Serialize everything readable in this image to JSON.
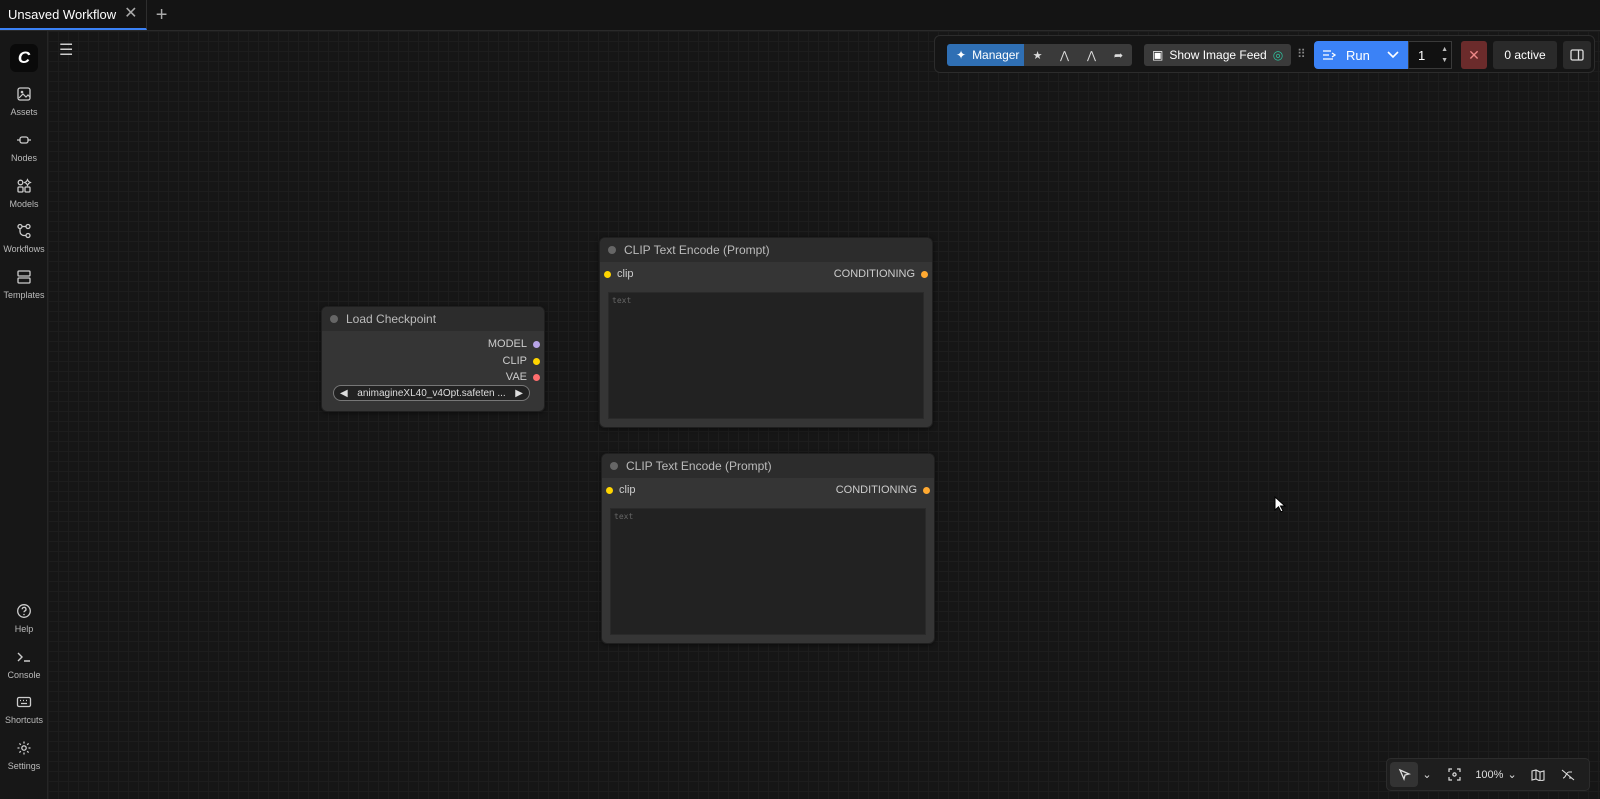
{
  "tabs": [
    {
      "title": "Unsaved Workflow",
      "close_icon": "close-icon"
    }
  ],
  "sidebar": {
    "logo": "C",
    "top_items": [
      {
        "label": "Assets",
        "icon": "image-icon"
      },
      {
        "label": "Nodes",
        "icon": "node-icon"
      },
      {
        "label": "Models",
        "icon": "models-icon"
      },
      {
        "label": "Workflows",
        "icon": "workflow-icon"
      },
      {
        "label": "Templates",
        "icon": "templates-icon"
      }
    ],
    "bottom_items": [
      {
        "label": "Help",
        "icon": "help-icon"
      },
      {
        "label": "Console",
        "icon": "terminal-icon"
      },
      {
        "label": "Shortcuts",
        "icon": "keyboard-icon"
      },
      {
        "label": "Settings",
        "icon": "gear-icon"
      }
    ]
  },
  "toolbar": {
    "manager_label": "Manager",
    "feed_label": "Show Image Feed",
    "run_label": "Run",
    "batch_count": "1",
    "active_label": "0 active"
  },
  "nodes": {
    "load_checkpoint": {
      "title": "Load Checkpoint",
      "outputs": [
        {
          "name": "MODEL",
          "color": "#b7a3e6"
        },
        {
          "name": "CLIP",
          "color": "#ffd500"
        },
        {
          "name": "VAE",
          "color": "#ff6e6e"
        }
      ],
      "ckpt_value": "animagineXL40_v4Opt.safeten ..."
    },
    "clip_encode_1": {
      "title": "CLIP Text Encode (Prompt)",
      "input": "clip",
      "output": "CONDITIONING",
      "placeholder": "text"
    },
    "clip_encode_2": {
      "title": "CLIP Text Encode (Prompt)",
      "input": "clip",
      "output": "CONDITIONING",
      "placeholder": "text"
    }
  },
  "zoom": {
    "level": "100%"
  },
  "colors": {
    "accent": "#3b82f6",
    "manager": "#2f6fb4",
    "clip_slot": "#ffd500",
    "conditioning_slot": "#ffa931"
  }
}
